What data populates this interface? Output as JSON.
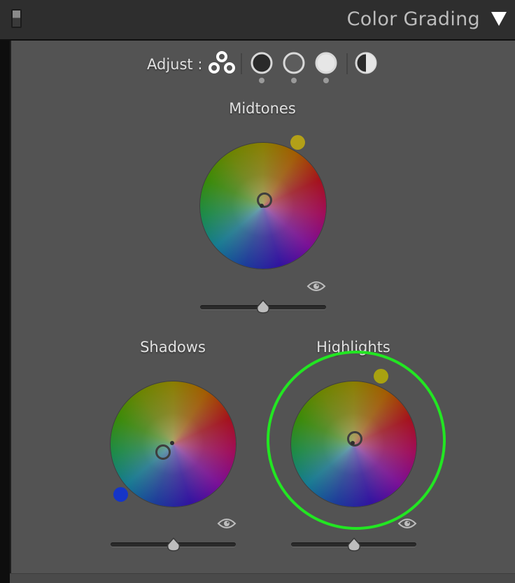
{
  "header": {
    "title": "Color Grading",
    "collapse_icon": "triangle-down-icon"
  },
  "toolbar": {
    "adjust_label": "Adjust :",
    "buttons": [
      {
        "name": "three-way-view",
        "icon": "three-circles-icon"
      },
      {
        "name": "shadows-view",
        "icon": "dark-circle-icon"
      },
      {
        "name": "midtones-view",
        "icon": "mid-circle-icon"
      },
      {
        "name": "highlights-view",
        "icon": "light-circle-icon"
      },
      {
        "name": "global-view",
        "icon": "half-circle-icon"
      }
    ]
  },
  "wheels": {
    "midtones": {
      "label": "Midtones",
      "swatch_color": "#b3a018",
      "slider": 0.5
    },
    "shadows": {
      "label": "Shadows",
      "swatch_color": "#1535c8",
      "slider": 0.5
    },
    "highlights": {
      "label": "Highlights",
      "swatch_color": "#a8a210",
      "slider": 0.5,
      "annotated": true
    }
  },
  "colors": {
    "panel_bg": "#535353",
    "annotation": "#22e622"
  }
}
